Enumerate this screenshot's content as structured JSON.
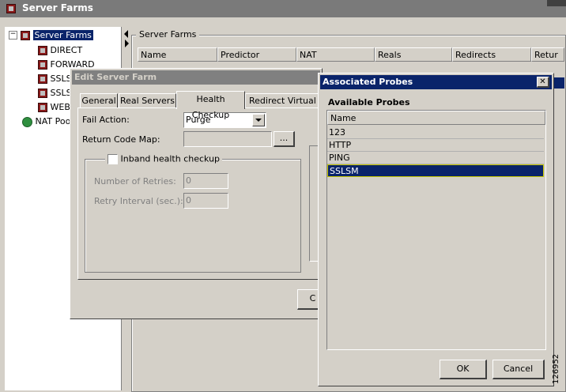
{
  "window": {
    "title": "Server Farms"
  },
  "tree": {
    "root": "Server Farms",
    "items": [
      "DIRECT",
      "FORWARD",
      "SSLS",
      "SSLS",
      "WEB"
    ],
    "nat": "NAT Poo"
  },
  "panel": {
    "group_title": "Server Farms",
    "columns": [
      "Name",
      "Predictor",
      "NAT",
      "Reals",
      "Redirects",
      "Retur"
    ]
  },
  "edit_dialog": {
    "title": "Edit Server Farm",
    "tabs": [
      "General",
      "Real Servers",
      "Health Checkup",
      "Redirect Virtual Se"
    ],
    "fail_action_label": "Fail Action:",
    "fail_action_value": "Purge",
    "return_code_label": "Return Code Map:",
    "browse_label": "...",
    "inband_label": "Inband health checkup",
    "retries_label": "Number of Retries:",
    "retries_value": "0",
    "retry_interval_label": "Retry Interval (sec.):",
    "retry_interval_value": "0",
    "partial_button": "C"
  },
  "probes_dialog": {
    "title": "Associated Probes",
    "close": "✕",
    "section_label": "Available Probes",
    "column": "Name",
    "rows": [
      "123",
      "HTTP",
      "PING",
      "SSLSM"
    ],
    "selected_index": 3,
    "ok": "OK",
    "cancel": "Cancel"
  },
  "side_code": "126952"
}
